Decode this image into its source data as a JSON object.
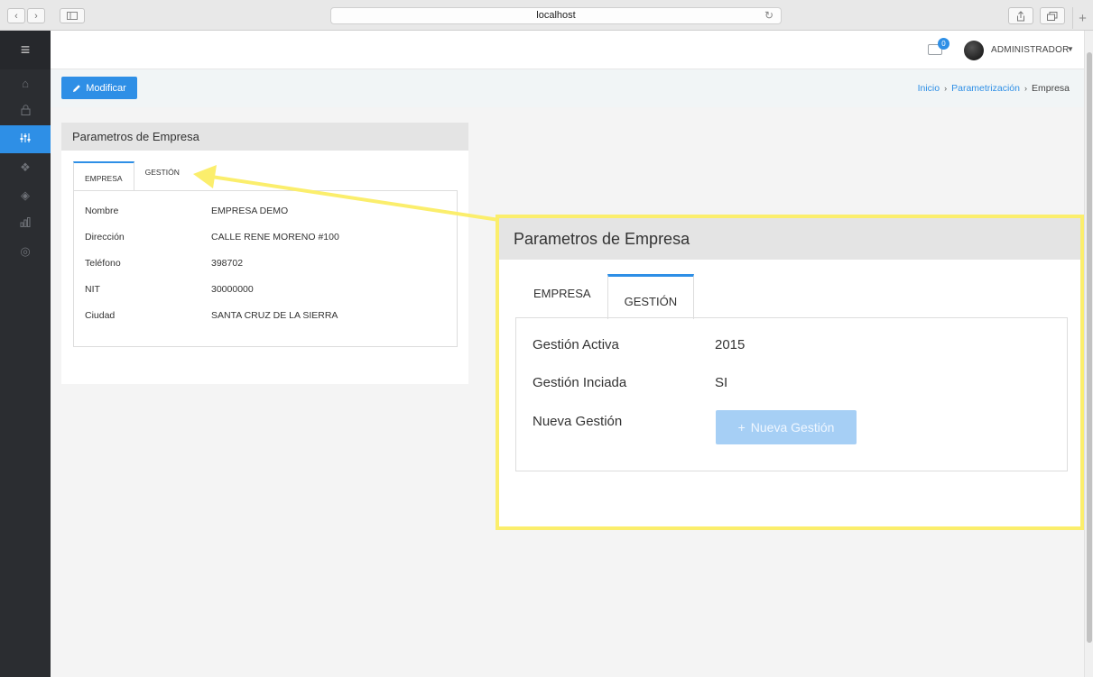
{
  "browser": {
    "url": "localhost",
    "back_glyph": "‹",
    "forward_glyph": "›",
    "new_tab_glyph": "+"
  },
  "sidebar": {
    "menu_icon": "hamburger-icon",
    "items": [
      {
        "icon": "home-icon",
        "glyph": "⌂"
      },
      {
        "icon": "lock-icon",
        "glyph": "🔒"
      },
      {
        "icon": "sliders-icon",
        "glyph": "⫶",
        "active": true
      },
      {
        "icon": "dropbox-icon",
        "glyph": "❖"
      },
      {
        "icon": "layers-icon",
        "glyph": "◈"
      },
      {
        "icon": "bar-chart-icon",
        "glyph": "▥"
      },
      {
        "icon": "lifebuoy-icon",
        "glyph": "◎"
      }
    ]
  },
  "header": {
    "notification_count": "0",
    "user_name": "ADMINISTRADOR",
    "caret": "▼"
  },
  "toolbar": {
    "modify_label": "Modificar",
    "breadcrumb": {
      "home": "Inicio",
      "section": "Parametrización",
      "current": "Empresa",
      "separator": "›"
    }
  },
  "panel": {
    "title": "Parametros de Empresa",
    "tabs": [
      "EMPRESA",
      "GESTIÓN"
    ],
    "fields": [
      {
        "label": "Nombre",
        "value": "EMPRESA DEMO"
      },
      {
        "label": "Dirección",
        "value": "CALLE RENE MORENO #100"
      },
      {
        "label": "Teléfono",
        "value": "398702"
      },
      {
        "label": "NIT",
        "value": "30000000"
      },
      {
        "label": "Ciudad",
        "value": "SANTA CRUZ DE LA SIERRA"
      }
    ]
  },
  "callout": {
    "title": "Parametros de Empresa",
    "tabs": [
      "EMPRESA",
      "GESTIÓN"
    ],
    "fields": [
      {
        "label": "Gestión Activa",
        "value": "2015"
      },
      {
        "label": "Gestión Inciada",
        "value": "SI"
      },
      {
        "label": "Nueva Gestión",
        "value": ""
      }
    ],
    "new_button_label": "Nueva Gestión",
    "new_button_glyph": "+"
  },
  "colors": {
    "accent": "#2e8fe6",
    "highlight": "#fbee6c",
    "sidebar": "#2b2d31"
  }
}
